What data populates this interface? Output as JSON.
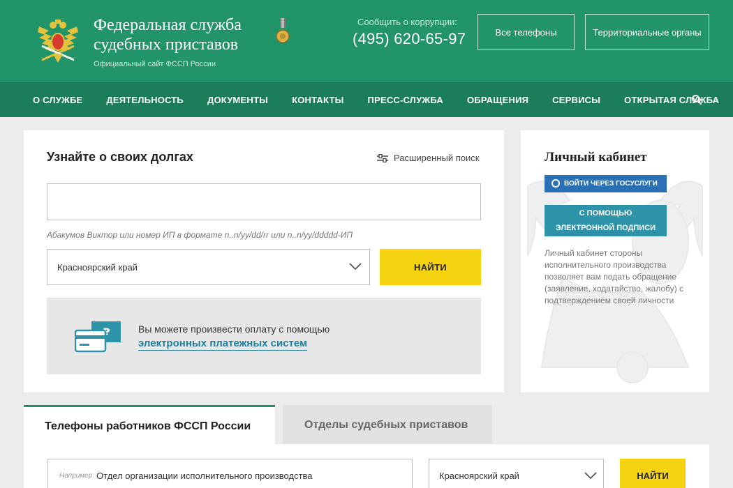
{
  "header": {
    "title_line1": "Федеральная служба",
    "title_line2": "судебных приставов",
    "subtitle": "Официальный сайт ФССП России",
    "corruption_label": "Сообщить о коррупции:",
    "corruption_phone": "(495) 620-65-97",
    "buttons": [
      "Все телефоны",
      "Территориальные органы"
    ],
    "brand_color": "#22946a"
  },
  "nav": {
    "items": [
      "О СЛУЖБЕ",
      "ДЕЯТЕЛЬНОСТЬ",
      "ДОКУМЕНТЫ",
      "КОНТАКТЫ",
      "ПРЕСС-СЛУЖБА",
      "ОБРАЩЕНИЯ",
      "СЕРВИСЫ",
      "ОТКРЫТАЯ СЛУЖБА"
    ],
    "search_icon": "search-icon"
  },
  "debt": {
    "title": "Узнайте о своих долгах",
    "advanced_search": "Расширенный поиск",
    "input_value": "",
    "hint": "Абакумов Виктор или номер ИП в формате n..n/yy/dd/rr или n..n/yy/ddddd-ИП",
    "region": "Красноярский край",
    "find_label": "НАЙТИ",
    "payment_text": "Вы можете произвести оплату с помощью",
    "payment_link": "электронных платежных систем",
    "accent_yellow": "#f5d311"
  },
  "cabinet": {
    "title": "Личный кабинет",
    "gosuslugi_button": "ВОЙТИ ЧЕРЕЗ ГОСУСЛУГИ",
    "esig_line1": "С ПОМОЩЬЮ",
    "esig_line2": "ЭЛЕКТРОННОЙ ПОДПИСИ",
    "description": "Личный кабинет стороны исполнительного производства позволяет вам подать обращение (заявление, ходатайство, жалобу) с подтверждением своей личности"
  },
  "tabs": {
    "active": "Телефоны работников ФССП России",
    "inactive": "Отделы судебных приставов"
  },
  "phones": {
    "example_label": "Например:",
    "input_value": "Отдел организации исполнительного производства",
    "region": "Красноярский край",
    "find_label": "НАЙТИ"
  }
}
